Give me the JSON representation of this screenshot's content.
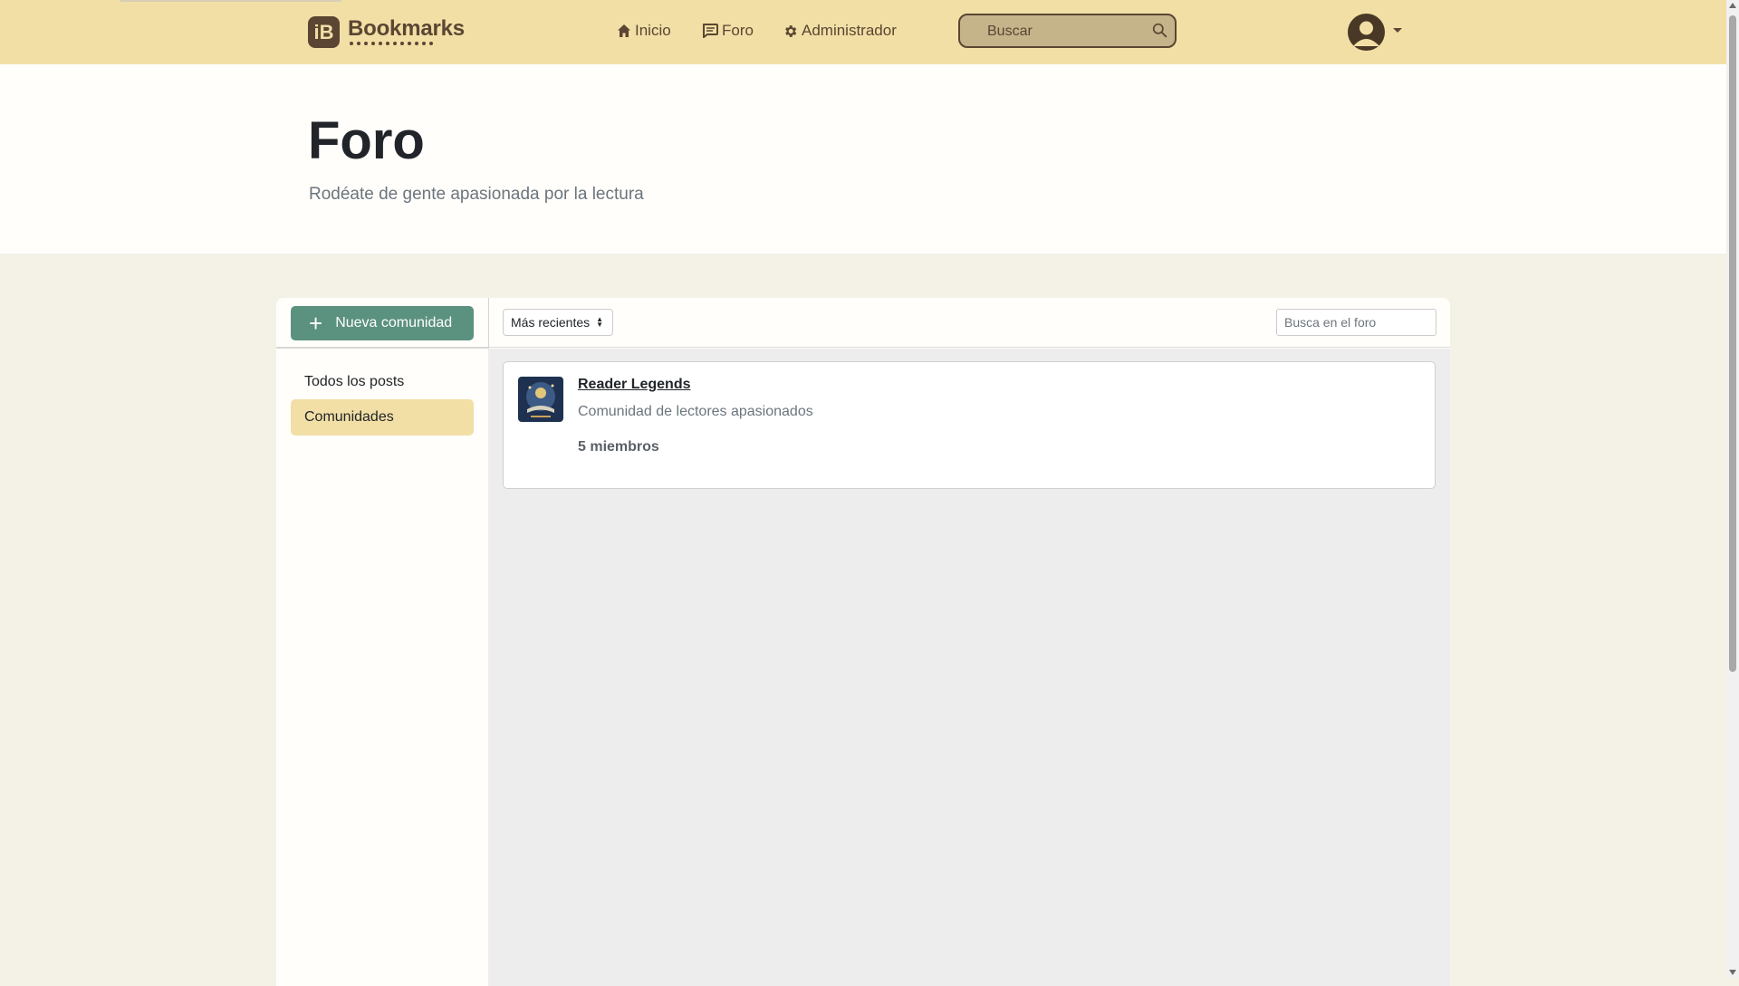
{
  "header": {
    "logo_mark": "iB",
    "logo_text": "Bookmarks",
    "nav": [
      {
        "label": "Inicio",
        "icon": "home-icon"
      },
      {
        "label": "Foro",
        "icon": "chat-icon"
      },
      {
        "label": "Administrador",
        "icon": "gear-icon"
      }
    ],
    "search_placeholder": "Buscar"
  },
  "hero": {
    "title": "Foro",
    "subtitle": "Rodéate de gente apasionada por la lectura"
  },
  "sidebar": {
    "new_button": "Nueva comunidad",
    "items": [
      {
        "label": "Todos los posts",
        "active": false
      },
      {
        "label": "Comunidades",
        "active": true
      }
    ]
  },
  "toolbar": {
    "sort_selected": "Más recientes",
    "search_placeholder": "Busca en el foro"
  },
  "communities": [
    {
      "name": "Reader Legends",
      "description": "Comunidad de lectores apasionados",
      "members": "5 miembros"
    }
  ],
  "colors": {
    "header_bg": "#f2dfa6",
    "brand_brown": "#5a4632",
    "accent_green": "#5b917f",
    "page_bg": "#f4f2e6"
  }
}
